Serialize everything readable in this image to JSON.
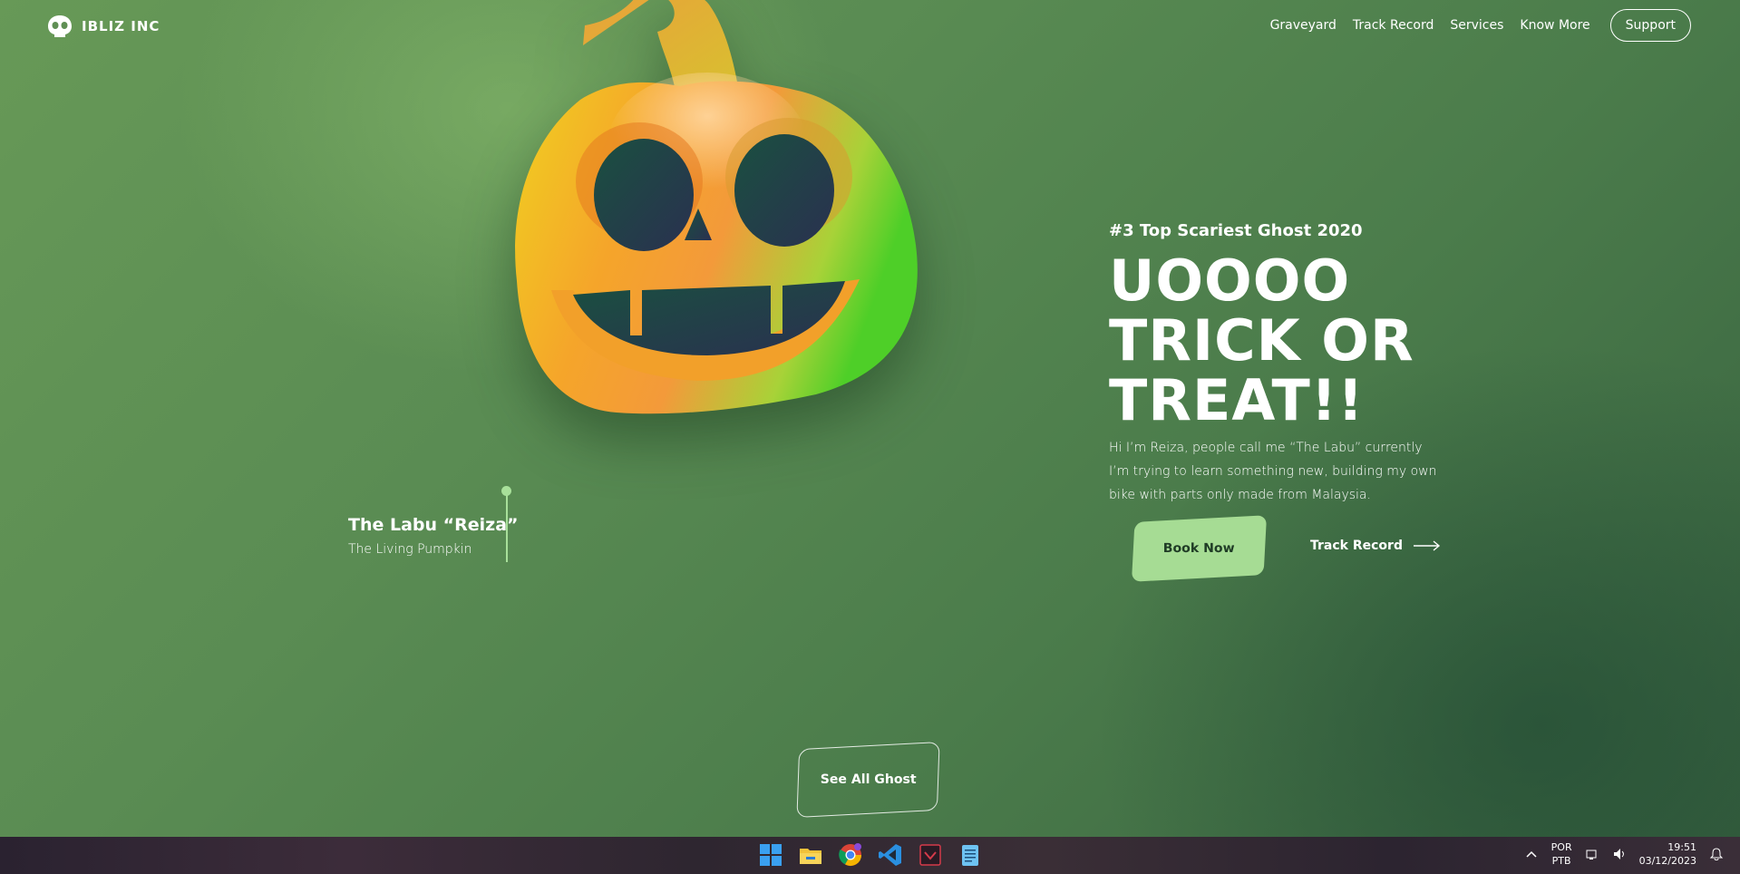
{
  "brand": {
    "name": "IBLIZ INC",
    "icon": "skull-icon"
  },
  "nav": {
    "links": [
      "Graveyard",
      "Track Record",
      "Services",
      "Know More"
    ],
    "support_label": "Support"
  },
  "character": {
    "name": "The Labu “Reiza”",
    "subtitle": "The Living Pumpkin"
  },
  "hero": {
    "rank": "#3 Top Scariest Ghost 2020",
    "title_line1": "UOOOO",
    "title_line2": "TRICK OR",
    "title_line3": "TREAT!!",
    "description": "Hi I’m Reiza, people call me “The Labu” currently I’m trying to learn something new, building my own bike with parts only made from Malaysia.",
    "book_label": "Book Now",
    "track_label": "Track Record"
  },
  "see_all_label": "See All Ghost",
  "taskbar": {
    "apps": [
      "windows-start-icon",
      "file-explorer-icon",
      "chrome-icon",
      "vscode-icon",
      "app-icon",
      "notepad-icon"
    ],
    "lang_top": "POR",
    "lang_bottom": "PTB",
    "time": "19:51",
    "date": "03/12/2023"
  },
  "colors": {
    "accent": "#a6dc94",
    "background": "#5a8c53",
    "pin": "#a8e09a"
  }
}
